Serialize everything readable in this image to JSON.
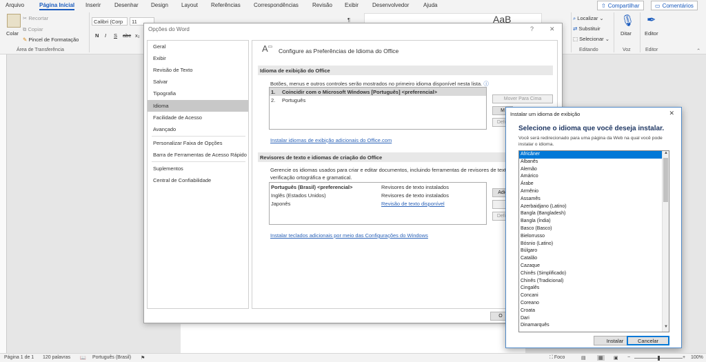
{
  "ribbon_tabs": [
    "Arquivo",
    "Página Inicial",
    "Inserir",
    "Desenhar",
    "Design",
    "Layout",
    "Referências",
    "Correspondências",
    "Revisão",
    "Exibir",
    "Desenvolvedor",
    "Ajuda"
  ],
  "top_buttons": {
    "share": "Compartilhar",
    "comments": "Comentários"
  },
  "ribbon": {
    "paste": "Colar",
    "cut": "Recortar",
    "copy": "Copiar",
    "format_painter": "Pincel de Formatação",
    "clipboard_group": "Área de Transferência",
    "font_name": "Calibri (Corp",
    "font_size": "11",
    "font_buttons": [
      "N",
      "I",
      "S",
      "abc",
      "x₂",
      "x²"
    ],
    "find": "Localizar",
    "replace": "Substituir",
    "select": "Selecionar",
    "editing_group": "Edit ando",
    "dictate": "Ditar",
    "voice_group": "Voz",
    "editor": "Editor",
    "editor_group": "Editor",
    "styles_sample": "AaB"
  },
  "options_dialog": {
    "title": "Opções do Word",
    "nav": [
      "Geral",
      "Exibir",
      "Revisão de Texto",
      "Salvar",
      "Tipografia",
      "Idioma",
      "Facilidade de Acesso",
      "Avançado",
      "Personalizar Faixa de Opções",
      "Barra de Ferramentas de Acesso Rápido",
      "Suplementos",
      "Central de Confiabilidade"
    ],
    "selected_nav": "Idioma",
    "header": "Configure as Preferências de Idioma do Office",
    "display_section": "Idioma de exibição do Office",
    "display_desc": "Botões, menus e outros controles serão mostrados no primeiro idioma disponível nesta lista.",
    "display_langs": [
      {
        "num": "1.",
        "name": "Coincidir com o Microsoft Windows [Português] <preferencial>"
      },
      {
        "num": "2.",
        "name": "Português"
      }
    ],
    "move_up": "Mover Para Cima",
    "move_down": "M",
    "set_preferred": "Defin",
    "install_display_link": "Instalar idiomas de exibição adicionais do Office.com",
    "proofing_section": "Revisores de texto e idiomas de criação do Office",
    "proofing_desc_1": "Gerencie os idiomas usados para criar e editar documentos, incluindo ferramentas de revisores de text",
    "proofing_desc_2": "verificação ortográfica e gramatical.",
    "proofing_rows": [
      {
        "lang": "Português (Brasil) <preferencial>",
        "status": "Revisores de texto instalados",
        "link": false
      },
      {
        "lang": "Inglês (Estados Unidos)",
        "status": "Revisores de texto instalados",
        "link": false
      },
      {
        "lang": "Japonês",
        "status": "Revisão de texto disponível",
        "link": true
      }
    ],
    "add": "Adic",
    "set_preferred_2": "Defin",
    "keyboards_link": "Instalar teclados adicionais por meio das Configurações do Windows",
    "ok_partial": "O"
  },
  "install_dialog": {
    "title": "Instalar um idioma de exibição",
    "heading": "Selecione o idioma que você deseja instalar.",
    "description": "Você será redirecionado para uma página da Web na qual você pode instalar o idioma.",
    "languages": [
      "Africâner",
      "Albanês",
      "Alemão",
      "Amárico",
      "Árabe",
      "Armênio",
      "Assamês",
      "Azerbaidjano (Latino)",
      "Bangla (Bangladesh)",
      "Bangla (Índia)",
      "Basco (Basco)",
      "Bielorrusso",
      "Bósnio (Latino)",
      "Búlgaro",
      "Catalão",
      "Cazaque",
      "Chinês (Simplificado)",
      "Chinês (Tradicional)",
      "Cingalês",
      "Concani",
      "Coreano",
      "Croata",
      "Dari",
      "Dinamarquês"
    ],
    "selected_language": "Africâner",
    "install_button": "Instalar",
    "cancel_button": "Cancelar"
  },
  "status_bar": {
    "page": "Página 1 de 1",
    "words": "120 palavras",
    "language": "Português (Brasil)",
    "focus": "Foco",
    "zoom": "100%"
  }
}
